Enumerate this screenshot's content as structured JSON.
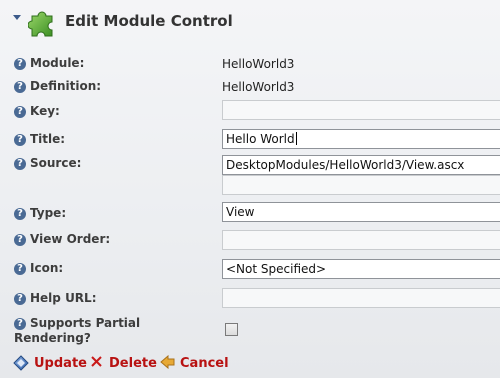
{
  "header": {
    "title": "Edit Module Control"
  },
  "form": {
    "module": {
      "label": "Module:",
      "value": "HelloWorld3"
    },
    "definition": {
      "label": "Definition:",
      "value": "HelloWorld3"
    },
    "key": {
      "label": "Key:",
      "value": ""
    },
    "title": {
      "label": "Title:",
      "value": "Hello World"
    },
    "source": {
      "label": "Source:",
      "value": "DesktopModules/HelloWorld3/View.ascx",
      "secondary": ""
    },
    "type": {
      "label": "Type:",
      "value": "View"
    },
    "view_order": {
      "label": "View Order:",
      "value": ""
    },
    "icon": {
      "label": "Icon:",
      "value": "<Not Specified>"
    },
    "help_url": {
      "label": "Help URL:",
      "value": ""
    },
    "supports_partial": {
      "label_line1": "Supports Partial",
      "label_line2": "Rendering?",
      "checked": false
    }
  },
  "actions": {
    "update": "Update",
    "delete": "Delete",
    "cancel": "Cancel"
  },
  "colors": {
    "action_text": "#b81212",
    "help_icon": "#4a6a94",
    "puzzle": "#5da93a"
  }
}
